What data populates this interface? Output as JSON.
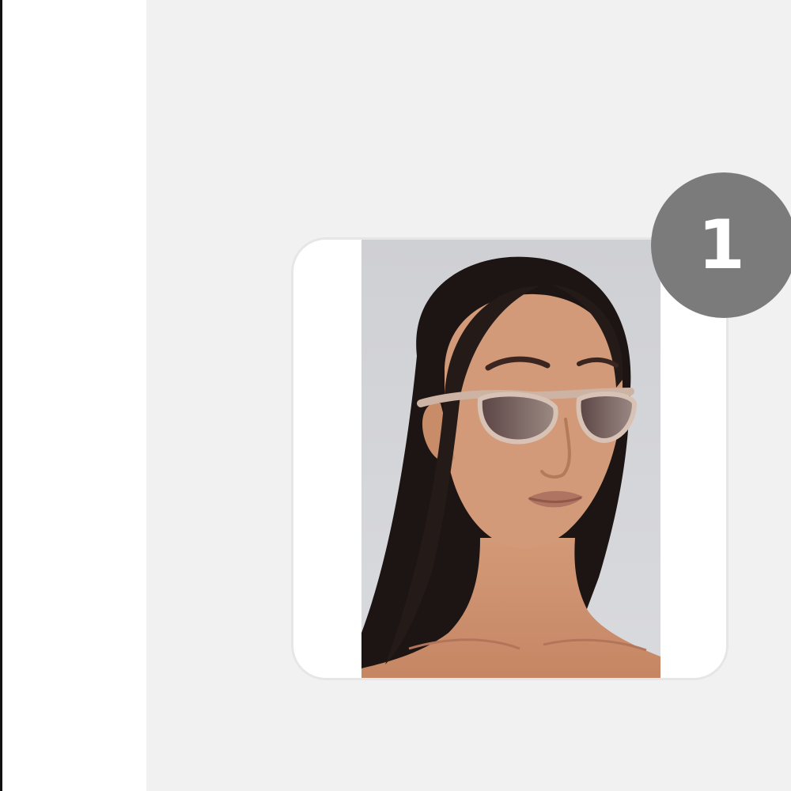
{
  "thumbnail": {
    "image": "product-photo-woman-sunglasses",
    "badge_count": "1"
  },
  "colors": {
    "content_background": "#f1f1f1",
    "badge_background": "#7b7b7b",
    "card_border": "#e6e6e6"
  }
}
